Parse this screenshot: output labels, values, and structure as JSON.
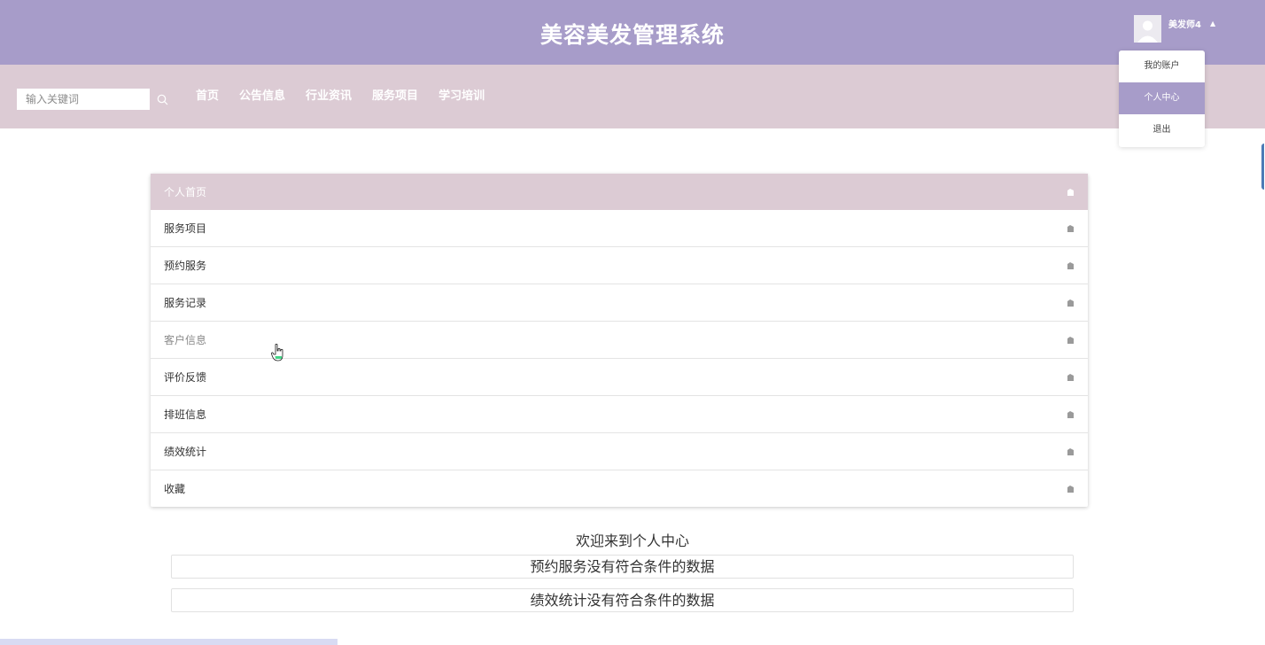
{
  "header": {
    "title": "美容美发管理系统",
    "user_name": "美发师4",
    "caret": "▲"
  },
  "user_menu": {
    "items": [
      {
        "label": "我的账户",
        "active": false
      },
      {
        "label": "个人中心",
        "active": true
      },
      {
        "label": "退出",
        "active": false
      }
    ]
  },
  "nav": {
    "search_placeholder": "输入关键词",
    "links": [
      "首页",
      "公告信息",
      "行业资讯",
      "服务项目",
      "学习培训"
    ]
  },
  "center_menu": {
    "items": [
      {
        "label": "个人首页",
        "state": "active"
      },
      {
        "label": "服务项目",
        "state": "normal"
      },
      {
        "label": "预约服务",
        "state": "normal"
      },
      {
        "label": "服务记录",
        "state": "normal"
      },
      {
        "label": "客户信息",
        "state": "hover"
      },
      {
        "label": "评价反馈",
        "state": "normal"
      },
      {
        "label": "排班信息",
        "state": "normal"
      },
      {
        "label": "绩效统计",
        "state": "normal"
      },
      {
        "label": "收藏",
        "state": "normal"
      }
    ]
  },
  "welcome": {
    "text": "欢迎来到个人中心",
    "empty_booking": "预约服务没有符合条件的数据",
    "empty_performance": "绩效统计没有符合条件的数据"
  },
  "colors": {
    "header_bg": "#a79cc9",
    "nav_bg": "#dccbd4",
    "active_item": "#dccbd4"
  },
  "icons": {
    "search": "search-icon",
    "menu_arrow": "chevron-right-icon",
    "avatar": "user-avatar-icon"
  }
}
